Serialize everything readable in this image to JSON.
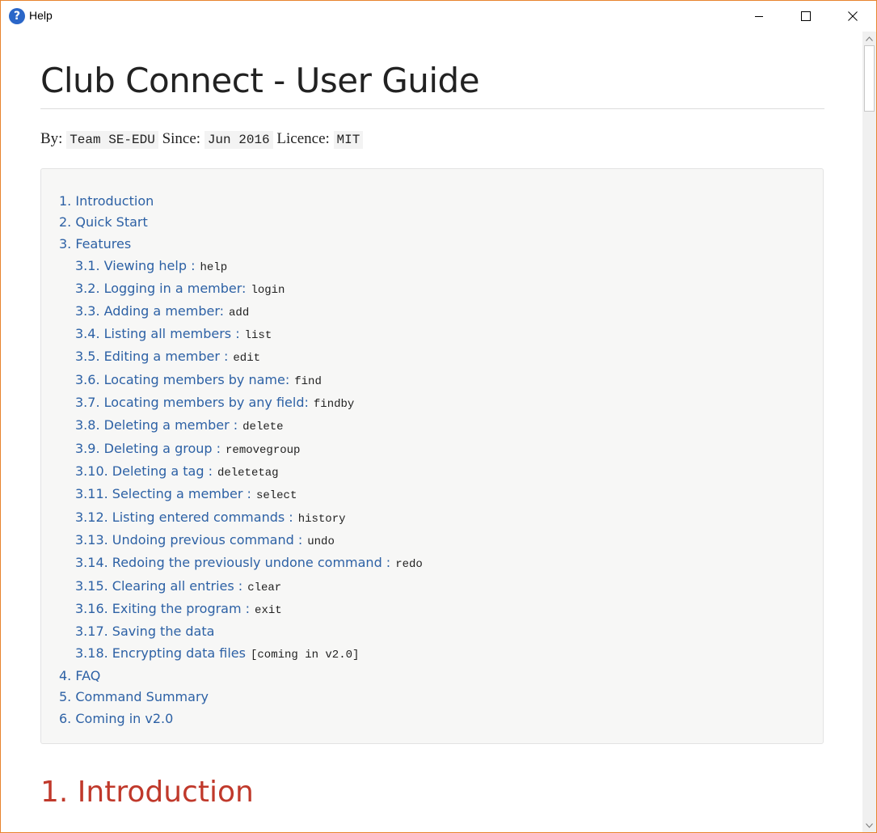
{
  "window": {
    "title": "Help",
    "app_icon_glyph": "?",
    "border_color": "#e8842e"
  },
  "controls": {
    "minimize": "minimize-icon",
    "maximize": "maximize-icon",
    "close": "close-icon"
  },
  "doc": {
    "title": "Club Connect - User Guide",
    "byline": {
      "by_label": "By:",
      "by_value": "Team SE-EDU",
      "since_label": "Since:",
      "since_value": "Jun 2016",
      "licence_label": "Licence:",
      "licence_value": "MIT"
    },
    "toc": [
      {
        "label": "1. Introduction",
        "code": "",
        "level": 1
      },
      {
        "label": "2. Quick Start",
        "code": "",
        "level": 1
      },
      {
        "label": "3. Features",
        "code": "",
        "level": 1
      },
      {
        "label": "3.1. Viewing help :",
        "code": "help",
        "level": 2
      },
      {
        "label": "3.2. Logging in a member:",
        "code": "login",
        "level": 2
      },
      {
        "label": "3.3. Adding a member:",
        "code": "add",
        "level": 2
      },
      {
        "label": "3.4. Listing all members :",
        "code": "list",
        "level": 2
      },
      {
        "label": "3.5. Editing a member :",
        "code": "edit",
        "level": 2
      },
      {
        "label": "3.6. Locating members by name:",
        "code": "find",
        "level": 2
      },
      {
        "label": "3.7. Locating members by any field:",
        "code": "findby",
        "level": 2
      },
      {
        "label": "3.8. Deleting a member :",
        "code": "delete",
        "level": 2
      },
      {
        "label": "3.9. Deleting a group :",
        "code": "removegroup",
        "level": 2
      },
      {
        "label": "3.10. Deleting a tag :",
        "code": "deletetag",
        "level": 2
      },
      {
        "label": "3.11. Selecting a member :",
        "code": "select",
        "level": 2
      },
      {
        "label": "3.12. Listing entered commands :",
        "code": "history",
        "level": 2
      },
      {
        "label": "3.13. Undoing previous command :",
        "code": "undo",
        "level": 2
      },
      {
        "label": "3.14. Redoing the previously undone command :",
        "code": "redo",
        "level": 2
      },
      {
        "label": "3.15. Clearing all entries :",
        "code": "clear",
        "level": 2
      },
      {
        "label": "3.16. Exiting the program :",
        "code": "exit",
        "level": 2
      },
      {
        "label": "3.17. Saving the data",
        "code": "",
        "level": 2
      },
      {
        "label": "3.18. Encrypting data files",
        "code": "[coming in v2.0]",
        "level": 2
      },
      {
        "label": "4. FAQ",
        "code": "",
        "level": 1
      },
      {
        "label": "5. Command Summary",
        "code": "",
        "level": 1
      },
      {
        "label": "6. Coming in v2.0",
        "code": "",
        "level": 1
      }
    ],
    "section_heading": "1. Introduction"
  },
  "colors": {
    "link": "#2d61a5",
    "heading_red": "#c0392b"
  }
}
